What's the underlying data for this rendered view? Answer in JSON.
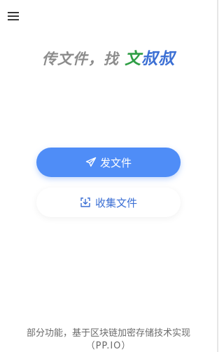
{
  "header": {
    "menu_icon": "hamburger-menu-icon"
  },
  "slogan": {
    "part1": "传文件，找 ",
    "wen": "文",
    "shu": "叔叔",
    "colors": {
      "gray": "#8c8c8c",
      "green": "#2f9e45",
      "blue": "#3b6fd4"
    }
  },
  "actions": {
    "send": {
      "label": "发文件",
      "icon": "paper-plane-icon",
      "color": "#4f8df7"
    },
    "collect": {
      "label": "收集文件",
      "icon": "download-tray-icon",
      "color": "#3b6fd4"
    }
  },
  "footer": {
    "line1": "部分功能，基于区块链加密存储技术实现",
    "line2": "（PP.IO）"
  }
}
